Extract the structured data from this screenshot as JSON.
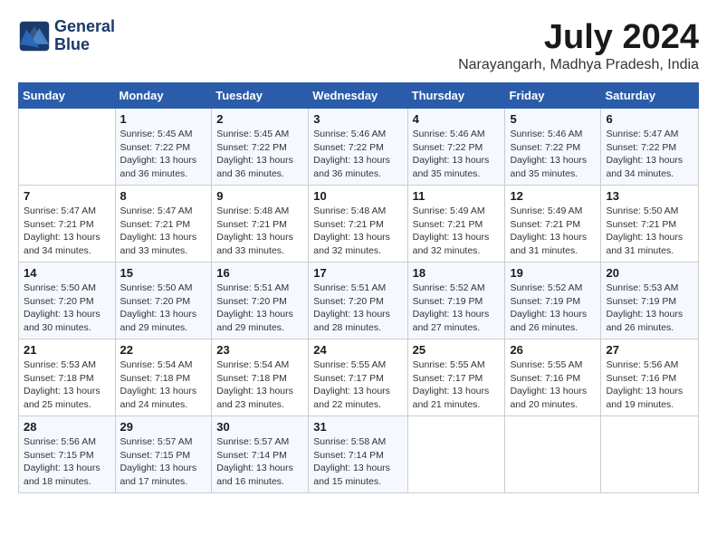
{
  "logo": {
    "line1": "General",
    "line2": "Blue"
  },
  "title": "July 2024",
  "location": "Narayangarh, Madhya Pradesh, India",
  "days_of_week": [
    "Sunday",
    "Monday",
    "Tuesday",
    "Wednesday",
    "Thursday",
    "Friday",
    "Saturday"
  ],
  "weeks": [
    [
      {
        "day": "",
        "info": ""
      },
      {
        "day": "1",
        "info": "Sunrise: 5:45 AM\nSunset: 7:22 PM\nDaylight: 13 hours\nand 36 minutes."
      },
      {
        "day": "2",
        "info": "Sunrise: 5:45 AM\nSunset: 7:22 PM\nDaylight: 13 hours\nand 36 minutes."
      },
      {
        "day": "3",
        "info": "Sunrise: 5:46 AM\nSunset: 7:22 PM\nDaylight: 13 hours\nand 36 minutes."
      },
      {
        "day": "4",
        "info": "Sunrise: 5:46 AM\nSunset: 7:22 PM\nDaylight: 13 hours\nand 35 minutes."
      },
      {
        "day": "5",
        "info": "Sunrise: 5:46 AM\nSunset: 7:22 PM\nDaylight: 13 hours\nand 35 minutes."
      },
      {
        "day": "6",
        "info": "Sunrise: 5:47 AM\nSunset: 7:22 PM\nDaylight: 13 hours\nand 34 minutes."
      }
    ],
    [
      {
        "day": "7",
        "info": "Sunrise: 5:47 AM\nSunset: 7:21 PM\nDaylight: 13 hours\nand 34 minutes."
      },
      {
        "day": "8",
        "info": "Sunrise: 5:47 AM\nSunset: 7:21 PM\nDaylight: 13 hours\nand 33 minutes."
      },
      {
        "day": "9",
        "info": "Sunrise: 5:48 AM\nSunset: 7:21 PM\nDaylight: 13 hours\nand 33 minutes."
      },
      {
        "day": "10",
        "info": "Sunrise: 5:48 AM\nSunset: 7:21 PM\nDaylight: 13 hours\nand 32 minutes."
      },
      {
        "day": "11",
        "info": "Sunrise: 5:49 AM\nSunset: 7:21 PM\nDaylight: 13 hours\nand 32 minutes."
      },
      {
        "day": "12",
        "info": "Sunrise: 5:49 AM\nSunset: 7:21 PM\nDaylight: 13 hours\nand 31 minutes."
      },
      {
        "day": "13",
        "info": "Sunrise: 5:50 AM\nSunset: 7:21 PM\nDaylight: 13 hours\nand 31 minutes."
      }
    ],
    [
      {
        "day": "14",
        "info": "Sunrise: 5:50 AM\nSunset: 7:20 PM\nDaylight: 13 hours\nand 30 minutes."
      },
      {
        "day": "15",
        "info": "Sunrise: 5:50 AM\nSunset: 7:20 PM\nDaylight: 13 hours\nand 29 minutes."
      },
      {
        "day": "16",
        "info": "Sunrise: 5:51 AM\nSunset: 7:20 PM\nDaylight: 13 hours\nand 29 minutes."
      },
      {
        "day": "17",
        "info": "Sunrise: 5:51 AM\nSunset: 7:20 PM\nDaylight: 13 hours\nand 28 minutes."
      },
      {
        "day": "18",
        "info": "Sunrise: 5:52 AM\nSunset: 7:19 PM\nDaylight: 13 hours\nand 27 minutes."
      },
      {
        "day": "19",
        "info": "Sunrise: 5:52 AM\nSunset: 7:19 PM\nDaylight: 13 hours\nand 26 minutes."
      },
      {
        "day": "20",
        "info": "Sunrise: 5:53 AM\nSunset: 7:19 PM\nDaylight: 13 hours\nand 26 minutes."
      }
    ],
    [
      {
        "day": "21",
        "info": "Sunrise: 5:53 AM\nSunset: 7:18 PM\nDaylight: 13 hours\nand 25 minutes."
      },
      {
        "day": "22",
        "info": "Sunrise: 5:54 AM\nSunset: 7:18 PM\nDaylight: 13 hours\nand 24 minutes."
      },
      {
        "day": "23",
        "info": "Sunrise: 5:54 AM\nSunset: 7:18 PM\nDaylight: 13 hours\nand 23 minutes."
      },
      {
        "day": "24",
        "info": "Sunrise: 5:55 AM\nSunset: 7:17 PM\nDaylight: 13 hours\nand 22 minutes."
      },
      {
        "day": "25",
        "info": "Sunrise: 5:55 AM\nSunset: 7:17 PM\nDaylight: 13 hours\nand 21 minutes."
      },
      {
        "day": "26",
        "info": "Sunrise: 5:55 AM\nSunset: 7:16 PM\nDaylight: 13 hours\nand 20 minutes."
      },
      {
        "day": "27",
        "info": "Sunrise: 5:56 AM\nSunset: 7:16 PM\nDaylight: 13 hours\nand 19 minutes."
      }
    ],
    [
      {
        "day": "28",
        "info": "Sunrise: 5:56 AM\nSunset: 7:15 PM\nDaylight: 13 hours\nand 18 minutes."
      },
      {
        "day": "29",
        "info": "Sunrise: 5:57 AM\nSunset: 7:15 PM\nDaylight: 13 hours\nand 17 minutes."
      },
      {
        "day": "30",
        "info": "Sunrise: 5:57 AM\nSunset: 7:14 PM\nDaylight: 13 hours\nand 16 minutes."
      },
      {
        "day": "31",
        "info": "Sunrise: 5:58 AM\nSunset: 7:14 PM\nDaylight: 13 hours\nand 15 minutes."
      },
      {
        "day": "",
        "info": ""
      },
      {
        "day": "",
        "info": ""
      },
      {
        "day": "",
        "info": ""
      }
    ]
  ]
}
